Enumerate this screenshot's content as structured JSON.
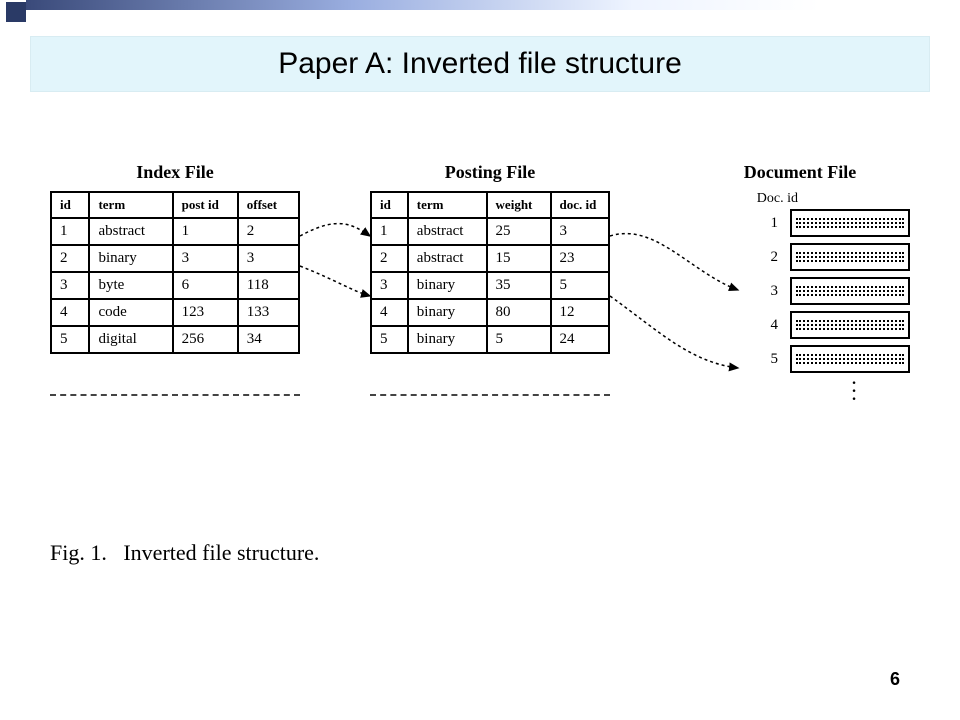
{
  "slide": {
    "title": "Paper A: Inverted file structure",
    "page_number": "6"
  },
  "figure": {
    "caption_label": "Fig. 1.",
    "caption_text": "Inverted file structure.",
    "index_file": {
      "title": "Index File",
      "headers": [
        "id",
        "term",
        "post id",
        "offset"
      ],
      "rows": [
        [
          "1",
          "abstract",
          "1",
          "2"
        ],
        [
          "2",
          "binary",
          "3",
          "3"
        ],
        [
          "3",
          "byte",
          "6",
          "118"
        ],
        [
          "4",
          "code",
          "123",
          "133"
        ],
        [
          "5",
          "digital",
          "256",
          "34"
        ]
      ]
    },
    "posting_file": {
      "title": "Posting File",
      "headers": [
        "id",
        "term",
        "weight",
        "doc. id"
      ],
      "rows": [
        [
          "1",
          "abstract",
          "25",
          "3"
        ],
        [
          "2",
          "abstract",
          "15",
          "23"
        ],
        [
          "3",
          "binary",
          "35",
          "5"
        ],
        [
          "4",
          "binary",
          "80",
          "12"
        ],
        [
          "5",
          "binary",
          "5",
          "24"
        ]
      ]
    },
    "document_file": {
      "title": "Document File",
      "doc_id_label": "Doc. id",
      "ids": [
        "1",
        "2",
        "3",
        "4",
        "5"
      ]
    }
  }
}
